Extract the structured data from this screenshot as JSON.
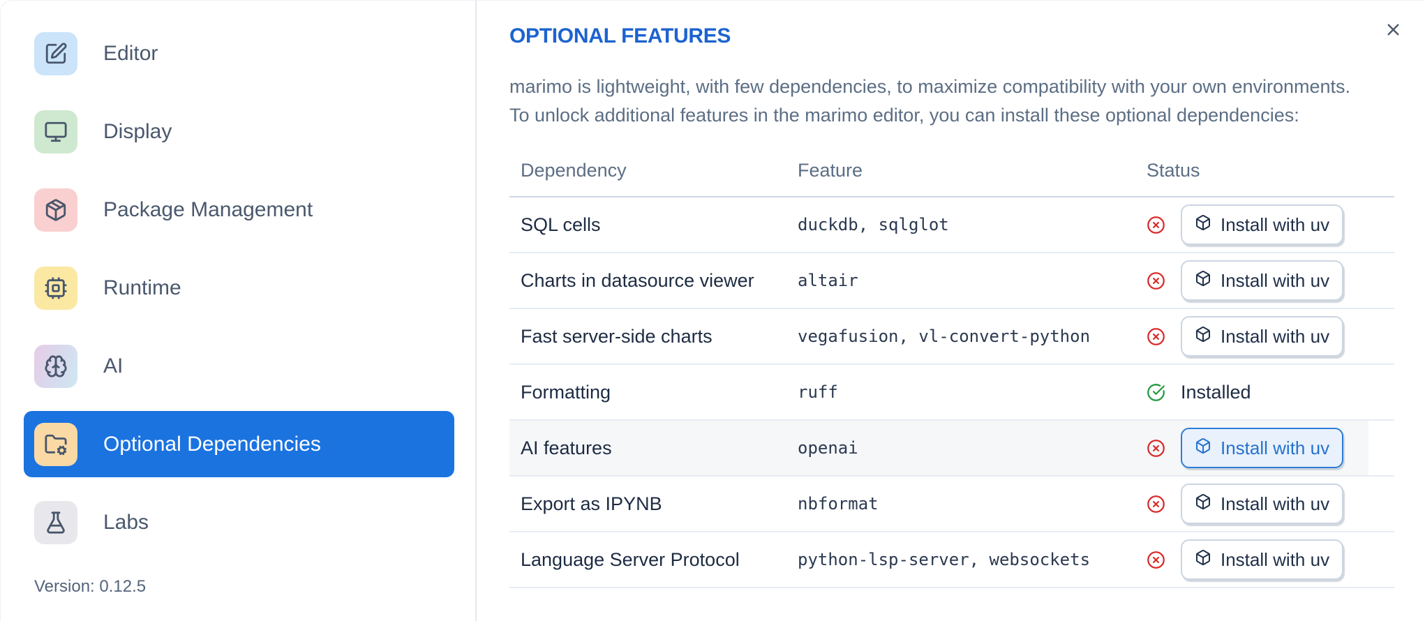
{
  "sidebar": {
    "items": [
      {
        "label": "Editor",
        "icon": "square-pen",
        "icon_bg": "#cbe4f9"
      },
      {
        "label": "Display",
        "icon": "monitor",
        "icon_bg": "#cfe9d0"
      },
      {
        "label": "Package Management",
        "icon": "package",
        "icon_bg": "#facfcf"
      },
      {
        "label": "Runtime",
        "icon": "cpu",
        "icon_bg": "#fbe8a3"
      },
      {
        "label": "AI",
        "icon": "brain",
        "icon_bg": "gradient(#e7cce6,#cfe8f0)"
      },
      {
        "label": "Optional Dependencies",
        "icon": "folder-cog",
        "icon_bg": "#fad9a5",
        "selected": true
      },
      {
        "label": "Labs",
        "icon": "flask-conical",
        "icon_bg": "#e8e8ec"
      }
    ],
    "version_label": "Version: 0.12.5"
  },
  "panel": {
    "title": "OPTIONAL FEATURES",
    "description_line1": "marimo is lightweight, with few dependencies, to maximize compatibility with your own environments.",
    "description_line2": "To unlock additional features in the marimo editor, you can install these optional dependencies:",
    "table": {
      "headers": {
        "dependency": "Dependency",
        "feature": "Feature",
        "status": "Status"
      },
      "rows": [
        {
          "dependency": "SQL cells",
          "feature": "duckdb, sqlglot",
          "status": "missing",
          "action_label": "Install with uv"
        },
        {
          "dependency": "Charts in datasource viewer",
          "feature": "altair",
          "status": "missing",
          "action_label": "Install with uv"
        },
        {
          "dependency": "Fast server-side charts",
          "feature": "vegafusion, vl-convert-python",
          "status": "missing",
          "action_label": "Install with uv"
        },
        {
          "dependency": "Formatting",
          "feature": "ruff",
          "status": "installed",
          "status_label": "Installed"
        },
        {
          "dependency": "AI features",
          "feature": "openai",
          "status": "missing",
          "action_label": "Install with uv",
          "highlighted": true
        },
        {
          "dependency": "Export as IPYNB",
          "feature": "nbformat",
          "status": "missing",
          "action_label": "Install with uv"
        },
        {
          "dependency": "Language Server Protocol",
          "feature": "python-lsp-server, websockets",
          "status": "missing",
          "action_label": "Install with uv"
        }
      ]
    }
  },
  "colors": {
    "selected_item_bg": "#1b73e0",
    "title_blue": "#1c63cf",
    "error_red": "#d92b2b",
    "success_green": "#23993f",
    "active_button_blue": "#2472cf",
    "row_highlight": "#f5f7f9",
    "divider": "#e3e8ef"
  }
}
